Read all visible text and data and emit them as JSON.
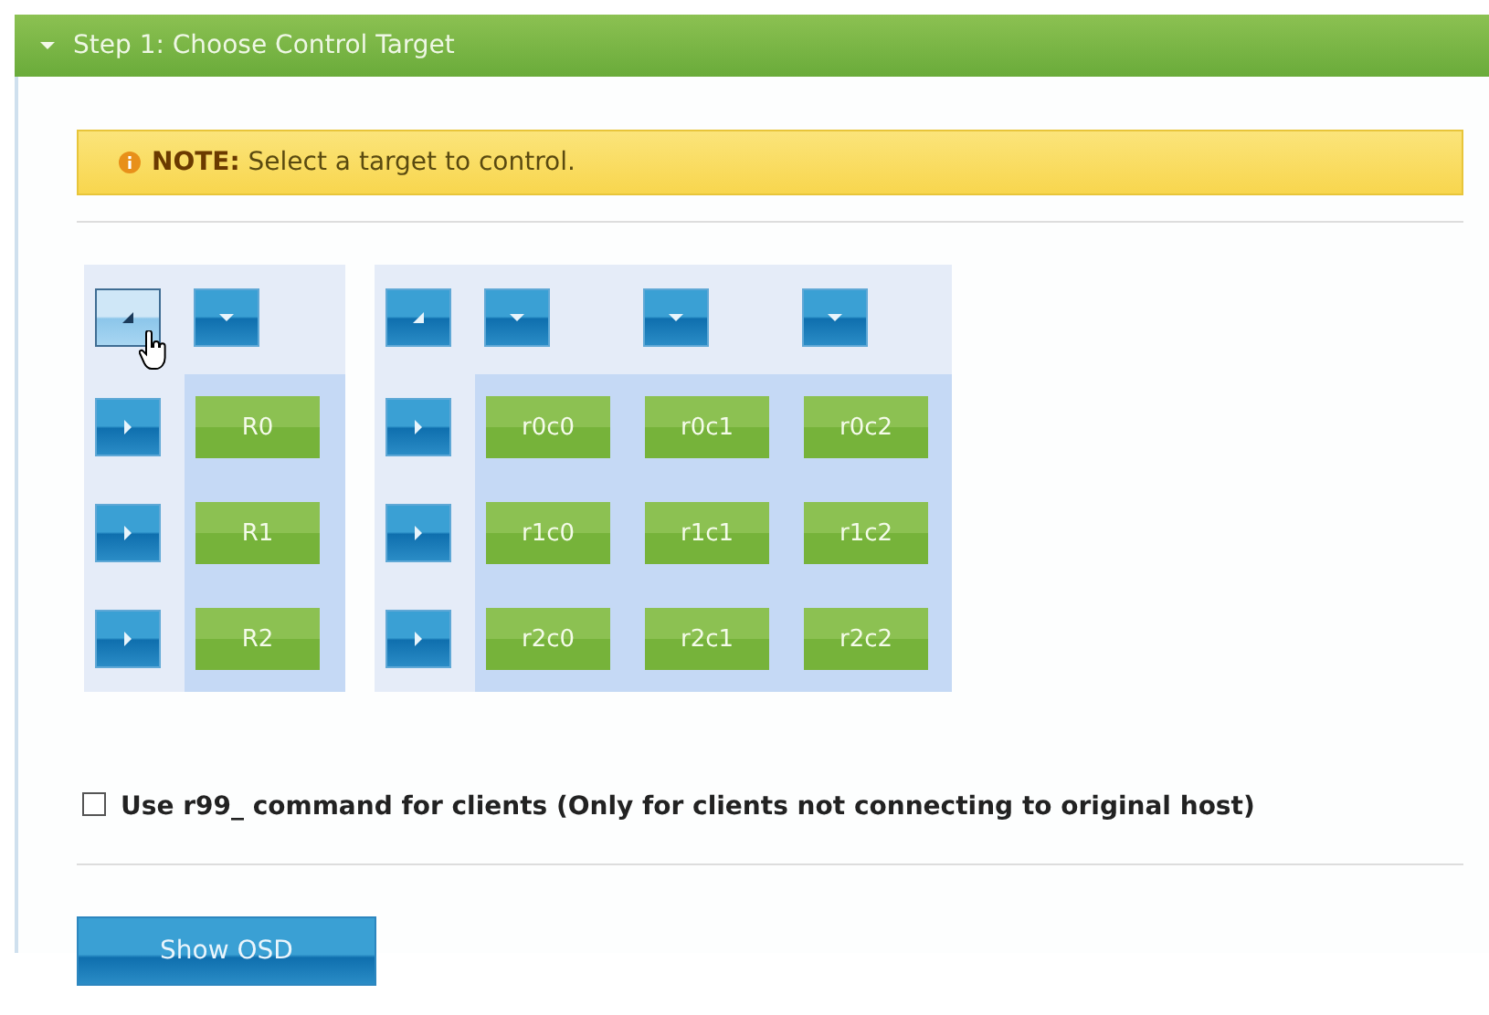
{
  "section": {
    "title": "Step 1: Choose Control Target",
    "expanded": true
  },
  "note": {
    "label": "NOTE:",
    "text": "Select a target to control."
  },
  "grids": [
    {
      "corner_highlighted": true,
      "rows": [
        {
          "cells": [
            "R0"
          ]
        },
        {
          "cells": [
            "R1"
          ]
        },
        {
          "cells": [
            "R2"
          ]
        }
      ]
    },
    {
      "corner_highlighted": false,
      "rows": [
        {
          "cells": [
            "r0c0",
            "r0c1",
            "r0c2"
          ]
        },
        {
          "cells": [
            "r1c0",
            "r1c1",
            "r1c2"
          ]
        },
        {
          "cells": [
            "r2c0",
            "r2c1",
            "r2c2"
          ]
        }
      ]
    }
  ],
  "option": {
    "checked": false,
    "label": "Use r99_ command for clients (Only for clients not connecting to original host)"
  },
  "button": "Show OSD"
}
